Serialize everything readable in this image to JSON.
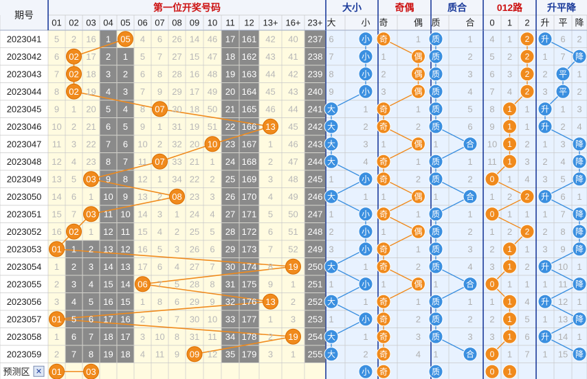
{
  "header": {
    "period_label": "期号",
    "group_title": "第一位开奖号码",
    "size_title": "大小",
    "parity_title": "奇偶",
    "prime_title": "质合",
    "mod_title": "012路",
    "trend_title": "升平降"
  },
  "columns": {
    "numbers": [
      "01",
      "02",
      "03",
      "04",
      "05",
      "06",
      "07",
      "08",
      "09",
      "10",
      "11",
      "12",
      "13+",
      "16+",
      "23+"
    ],
    "size": [
      "大",
      "小"
    ],
    "parity": [
      "奇",
      "偶"
    ],
    "prime": [
      "质",
      "合"
    ],
    "mod": [
      "0",
      "1",
      "2"
    ],
    "trend": [
      "升",
      "平",
      "降"
    ]
  },
  "labels": {
    "big": "大",
    "small": "小",
    "odd": "奇",
    "even": "偶",
    "prime": "质",
    "composite": "合",
    "up": "升",
    "flat": "平",
    "down": "降"
  },
  "footer": {
    "predict_label": "预测区",
    "close_symbol": "✕",
    "predict_numbers": [
      "01",
      "03"
    ],
    "predict_size": "小",
    "predict_parity": "奇",
    "predict_prime": "质",
    "predict_mod": [
      "0",
      "1"
    ]
  },
  "colors": {
    "orange": "#f08a1c",
    "blue": "#3a8fe0",
    "gray_cell": "#8a8a8a",
    "light_yellow": "#fffbe0",
    "light_blue": "#e8f2ff",
    "header_red": "#cc1111",
    "header_blue": "#1a3a9a"
  },
  "chart_data": {
    "type": "table",
    "periods": [
      "2023041",
      "2023042",
      "2023043",
      "2023044",
      "2023045",
      "2023046",
      "2023047",
      "2023048",
      "2023049",
      "2023050",
      "2023051",
      "2023052",
      "2023053",
      "2023054",
      "2023055",
      "2023056",
      "2023057",
      "2023058",
      "2023059"
    ],
    "winning_first_number": [
      5,
      2,
      2,
      2,
      7,
      13,
      10,
      7,
      3,
      8,
      3,
      2,
      1,
      19,
      6,
      13,
      1,
      19,
      9
    ],
    "rows": [
      [
        "5",
        "2",
        "16",
        "1",
        "05",
        "4",
        "6",
        "26",
        "14",
        "46",
        "17",
        "161",
        "42",
        "40",
        "237"
      ],
      [
        "6",
        "02",
        "17",
        "2",
        "1",
        "5",
        "7",
        "27",
        "15",
        "47",
        "18",
        "162",
        "43",
        "41",
        "238"
      ],
      [
        "7",
        "02",
        "18",
        "3",
        "2",
        "6",
        "8",
        "28",
        "16",
        "48",
        "19",
        "163",
        "44",
        "42",
        "239"
      ],
      [
        "8",
        "02",
        "19",
        "4",
        "3",
        "7",
        "9",
        "29",
        "17",
        "49",
        "20",
        "164",
        "45",
        "43",
        "240"
      ],
      [
        "9",
        "1",
        "20",
        "5",
        "4",
        "8",
        "07",
        "30",
        "18",
        "50",
        "21",
        "165",
        "46",
        "44",
        "241"
      ],
      [
        "10",
        "2",
        "21",
        "6",
        "5",
        "9",
        "1",
        "31",
        "19",
        "51",
        "22",
        "166",
        "13",
        "45",
        "242"
      ],
      [
        "11",
        "3",
        "22",
        "7",
        "6",
        "10",
        "2",
        "32",
        "20",
        "10",
        "23",
        "167",
        "1",
        "46",
        "243"
      ],
      [
        "12",
        "4",
        "23",
        "8",
        "7",
        "11",
        "07",
        "33",
        "21",
        "1",
        "24",
        "168",
        "2",
        "47",
        "244"
      ],
      [
        "13",
        "5",
        "03",
        "9",
        "8",
        "12",
        "1",
        "34",
        "22",
        "2",
        "25",
        "169",
        "3",
        "48",
        "245"
      ],
      [
        "14",
        "6",
        "1",
        "10",
        "9",
        "13",
        "2",
        "08",
        "23",
        "3",
        "26",
        "170",
        "4",
        "49",
        "246"
      ],
      [
        "15",
        "7",
        "03",
        "11",
        "10",
        "14",
        "3",
        "1",
        "24",
        "4",
        "27",
        "171",
        "5",
        "50",
        "247"
      ],
      [
        "16",
        "02",
        "1",
        "12",
        "11",
        "15",
        "4",
        "2",
        "25",
        "5",
        "28",
        "172",
        "6",
        "51",
        "248"
      ],
      [
        "01",
        "1",
        "2",
        "13",
        "12",
        "16",
        "5",
        "3",
        "26",
        "6",
        "29",
        "173",
        "7",
        "52",
        "249"
      ],
      [
        "1",
        "2",
        "3",
        "14",
        "13",
        "17",
        "6",
        "4",
        "27",
        "7",
        "30",
        "174",
        "8",
        "19",
        "250"
      ],
      [
        "2",
        "3",
        "4",
        "15",
        "14",
        "06",
        "7",
        "5",
        "28",
        "8",
        "31",
        "175",
        "9",
        "1",
        "251"
      ],
      [
        "3",
        "4",
        "5",
        "16",
        "15",
        "1",
        "8",
        "6",
        "29",
        "9",
        "32",
        "176",
        "13",
        "2",
        "252"
      ],
      [
        "01",
        "5",
        "6",
        "17",
        "16",
        "2",
        "9",
        "7",
        "30",
        "10",
        "33",
        "177",
        "1",
        "3",
        "253"
      ],
      [
        "1",
        "6",
        "7",
        "18",
        "17",
        "3",
        "10",
        "8",
        "31",
        "11",
        "34",
        "178",
        "2",
        "19",
        "254"
      ],
      [
        "2",
        "7",
        "8",
        "19",
        "18",
        "4",
        "11",
        "9",
        "09",
        "12",
        "35",
        "179",
        "3",
        "1",
        "255"
      ]
    ],
    "hit_columns": [
      4,
      1,
      1,
      1,
      6,
      12,
      9,
      6,
      2,
      7,
      2,
      1,
      0,
      13,
      5,
      12,
      0,
      13,
      8
    ],
    "gray_ranges": [
      [
        3,
        4
      ],
      [
        3,
        4
      ],
      [
        3,
        4
      ],
      [
        3,
        4
      ],
      [
        3,
        4
      ],
      [
        3,
        4
      ],
      [
        3,
        4
      ],
      [
        3,
        4
      ],
      [
        3,
        4
      ],
      [
        3,
        4
      ],
      [
        3,
        4
      ],
      [
        3,
        4
      ],
      [
        1,
        4
      ],
      [
        1,
        4
      ],
      [
        1,
        4
      ],
      [
        1,
        4
      ],
      [
        1,
        4
      ],
      [
        1,
        4
      ],
      [
        1,
        4
      ]
    ],
    "size": [
      [
        "6",
        "小"
      ],
      [
        "7",
        "小"
      ],
      [
        "8",
        "小"
      ],
      [
        "9",
        "小"
      ],
      [
        "大",
        "1"
      ],
      [
        "大",
        "2"
      ],
      [
        "大",
        "3"
      ],
      [
        "大",
        "4"
      ],
      [
        "1",
        "小"
      ],
      [
        "大",
        "1"
      ],
      [
        "1",
        "小"
      ],
      [
        "2",
        "小"
      ],
      [
        "3",
        "小"
      ],
      [
        "大",
        "1"
      ],
      [
        "1",
        "小"
      ],
      [
        "大",
        "1"
      ],
      [
        "1",
        "小"
      ],
      [
        "大",
        "1"
      ],
      [
        "大",
        "2"
      ]
    ],
    "parity": [
      [
        "奇",
        "1"
      ],
      [
        "1",
        "偶"
      ],
      [
        "2",
        "偶"
      ],
      [
        "3",
        "偶"
      ],
      [
        "奇",
        "1"
      ],
      [
        "奇",
        "2"
      ],
      [
        "1",
        "偶"
      ],
      [
        "奇",
        "1"
      ],
      [
        "奇",
        "2"
      ],
      [
        "1",
        "偶"
      ],
      [
        "奇",
        "1"
      ],
      [
        "1",
        "偶"
      ],
      [
        "奇",
        "1"
      ],
      [
        "奇",
        "2"
      ],
      [
        "1",
        "偶"
      ],
      [
        "奇",
        "1"
      ],
      [
        "奇",
        "2"
      ],
      [
        "奇",
        "3"
      ],
      [
        "奇",
        "4"
      ]
    ],
    "prime": [
      [
        "质",
        "1"
      ],
      [
        "质",
        "2"
      ],
      [
        "质",
        "3"
      ],
      [
        "质",
        "4"
      ],
      [
        "质",
        "5"
      ],
      [
        "质",
        "6"
      ],
      [
        "1",
        "合"
      ],
      [
        "质",
        "1"
      ],
      [
        "质",
        "2"
      ],
      [
        "1",
        "合"
      ],
      [
        "质",
        "1"
      ],
      [
        "质",
        "2"
      ],
      [
        "质",
        "3"
      ],
      [
        "质",
        "4"
      ],
      [
        "1",
        "合"
      ],
      [
        "质",
        "1"
      ],
      [
        "质",
        "2"
      ],
      [
        "质",
        "3"
      ],
      [
        "1",
        "合"
      ]
    ],
    "mod": [
      [
        "4",
        "1",
        "2"
      ],
      [
        "5",
        "2",
        "2"
      ],
      [
        "6",
        "3",
        "2"
      ],
      [
        "7",
        "4",
        "2"
      ],
      [
        "8",
        "1",
        "1"
      ],
      [
        "9",
        "1",
        "1"
      ],
      [
        "10",
        "1",
        "2"
      ],
      [
        "11",
        "1",
        "3"
      ],
      [
        "0",
        "1",
        "4"
      ],
      [
        "1",
        "2",
        "2"
      ],
      [
        "0",
        "1",
        "1"
      ],
      [
        "1",
        "2",
        "2"
      ],
      [
        "2",
        "1",
        "1"
      ],
      [
        "3",
        "1",
        "2"
      ],
      [
        "0",
        "1",
        "1"
      ],
      [
        "1",
        "1",
        "4"
      ],
      [
        "2",
        "1",
        "5"
      ],
      [
        "3",
        "1",
        "6"
      ],
      [
        "0",
        "1",
        "7"
      ]
    ],
    "trend": [
      [
        "升",
        "6",
        "2"
      ],
      [
        "1",
        "7",
        "降"
      ],
      [
        "2",
        "平",
        "1"
      ],
      [
        "3",
        "平",
        "2"
      ],
      [
        "升",
        "1",
        "3"
      ],
      [
        "升",
        "2",
        "4"
      ],
      [
        "1",
        "3",
        "降"
      ],
      [
        "2",
        "4",
        "降"
      ],
      [
        "3",
        "5",
        "降"
      ],
      [
        "升",
        "6",
        "1"
      ],
      [
        "1",
        "7",
        "降"
      ],
      [
        "2",
        "8",
        "降"
      ],
      [
        "3",
        "9",
        "降"
      ],
      [
        "升",
        "10",
        "1"
      ],
      [
        "1",
        "11",
        "降"
      ],
      [
        "升",
        "12",
        "1"
      ],
      [
        "1",
        "13",
        "降"
      ],
      [
        "升",
        "14",
        "1"
      ],
      [
        "1",
        "15",
        "降"
      ]
    ]
  }
}
